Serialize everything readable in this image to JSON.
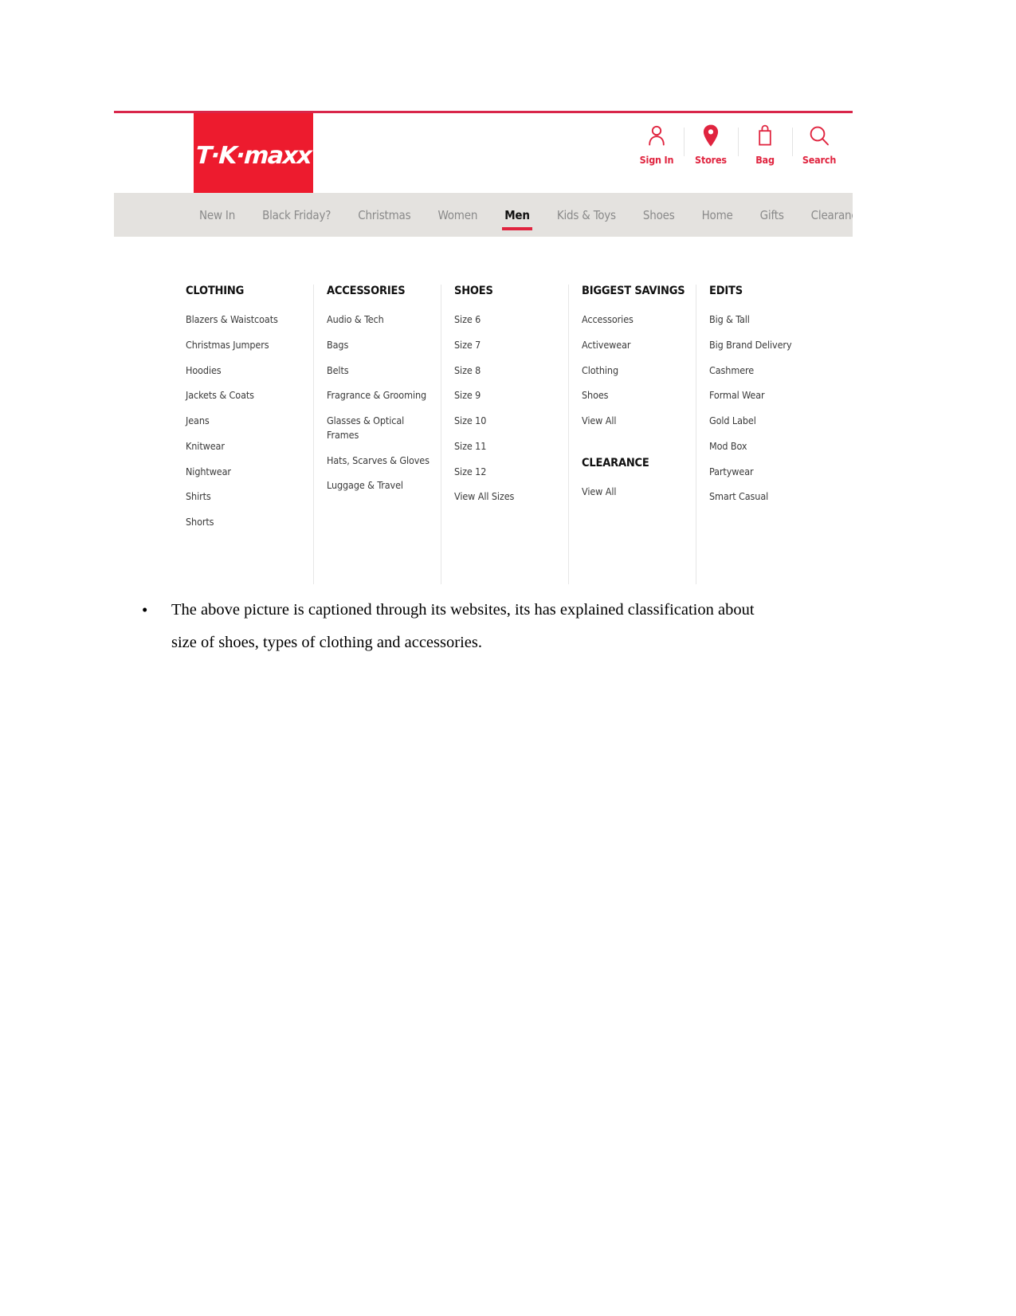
{
  "site": {
    "brand": "T·K·maxx",
    "accent_red": "#e0243f",
    "logo_red": "#ed1b2e",
    "nav_bar_bg": "#e4e2df"
  },
  "utility_nav": [
    {
      "label": "Sign In",
      "icon": "user-icon"
    },
    {
      "label": "Stores",
      "icon": "location-pin-icon"
    },
    {
      "label": "Bag",
      "icon": "shopping-bag-icon"
    },
    {
      "label": "Search",
      "icon": "search-icon"
    }
  ],
  "main_nav": [
    {
      "label": "New In",
      "active": false
    },
    {
      "label": "Black Friday?",
      "active": false
    },
    {
      "label": "Christmas",
      "active": false
    },
    {
      "label": "Women",
      "active": false
    },
    {
      "label": "Men",
      "active": true
    },
    {
      "label": "Kids & Toys",
      "active": false
    },
    {
      "label": "Shoes",
      "active": false
    },
    {
      "label": "Home",
      "active": false
    },
    {
      "label": "Gifts",
      "active": false
    },
    {
      "label": "Clearance",
      "active": false
    }
  ],
  "mega_menu": {
    "columns": [
      {
        "heading": "CLOTHING",
        "items": [
          "Blazers & Waistcoats",
          "Christmas Jumpers",
          "Hoodies",
          "Jackets & Coats",
          "Jeans",
          "Knitwear",
          "Nightwear",
          "Shirts",
          "Shorts"
        ]
      },
      {
        "heading": "ACCESSORIES",
        "items": [
          "Audio & Tech",
          "Bags",
          "Belts",
          "Fragrance & Grooming",
          "Glasses & Optical Frames",
          "Hats, Scarves & Gloves",
          "Luggage & Travel"
        ]
      },
      {
        "heading": "SHOES",
        "items": [
          "Size 6",
          "Size 7",
          "Size 8",
          "Size 9",
          "Size 10",
          "Size 11",
          "Size 12",
          "View All Sizes"
        ]
      },
      {
        "heading": "BIGGEST SAVINGS",
        "items": [
          "Accessories",
          "Activewear",
          "Clothing",
          "Shoes",
          "View All"
        ],
        "heading2": "CLEARANCE",
        "items2": [
          "View All"
        ]
      },
      {
        "heading": "EDITS",
        "items": [
          "Big & Tall",
          "Big Brand Delivery",
          "Cashmere",
          "Formal Wear",
          "Gold Label",
          "Mod Box",
          "Partywear",
          "Smart Casual"
        ]
      }
    ]
  },
  "document": {
    "bullet_marker": "•",
    "caption_line1": "The above picture is captioned through its websites, its has explained classification about",
    "caption_line2": "size of shoes, types of clothing and accessories."
  }
}
